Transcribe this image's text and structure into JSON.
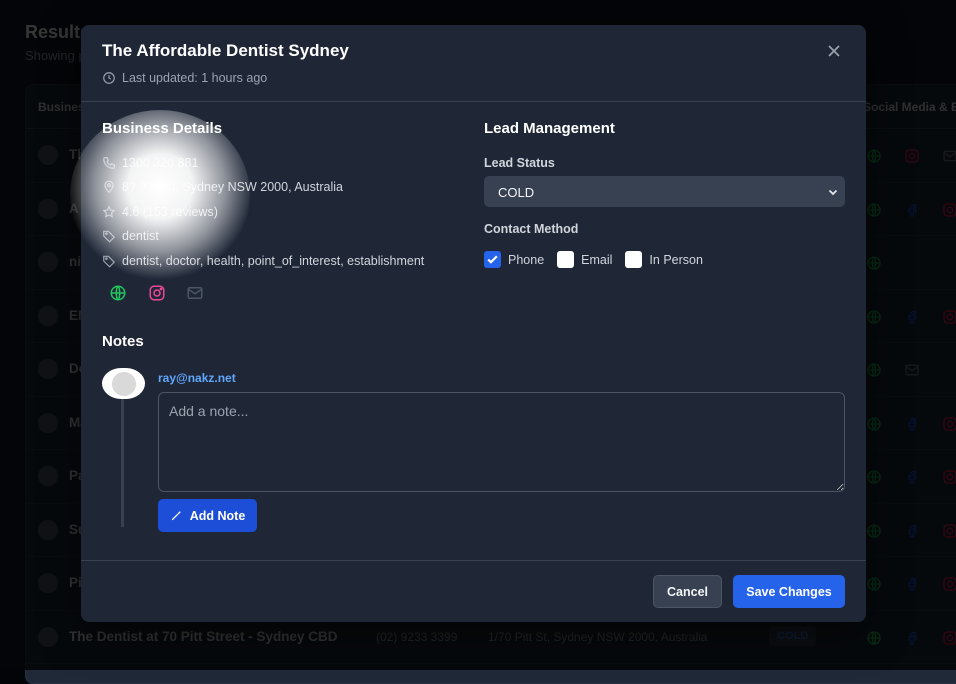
{
  "background": {
    "title": "Results",
    "subtitle": "Showing p",
    "columns": {
      "business": "Business",
      "social": "Social Media & E"
    },
    "rows": [
      {
        "name": "Th",
        "social": [
          "globe",
          "instagram",
          "mail"
        ]
      },
      {
        "name": "A",
        "social": [
          "globe",
          "facebook",
          "instagram"
        ]
      },
      {
        "name": "ni",
        "social": [
          "globe"
        ]
      },
      {
        "name": "EM",
        "social": [
          "globe",
          "facebook",
          "instagram"
        ]
      },
      {
        "name": "De",
        "social": [
          "globe",
          "mail"
        ]
      },
      {
        "name": "Ma",
        "social": [
          "globe",
          "facebook",
          "instagram"
        ]
      },
      {
        "name": "Pa",
        "social": [
          "globe",
          "facebook",
          "instagram"
        ]
      },
      {
        "name": "Su",
        "social": [
          "globe",
          "facebook",
          "instagram"
        ]
      },
      {
        "name": "Pi",
        "social": [
          "globe",
          "facebook",
          "instagram"
        ]
      },
      {
        "name": "The Dentist at 70 Pitt Street - Sydney CBD",
        "phone": "(02) 9233 3399",
        "address": "1/70 Pitt St, Sydney NSW 2000, Australia",
        "status": "COLD",
        "social": [
          "globe",
          "facebook",
          "instagram"
        ]
      }
    ]
  },
  "modal": {
    "title": "The Affordable Dentist Sydney",
    "last_updated": "Last updated: 1 hours ago",
    "business_details": {
      "heading": "Business Details",
      "phone": "1300 320 881",
      "address": "8? ??? St, Sydney NSW 2000, Australia",
      "rating": "4.6 (153 reviews)",
      "primary_type": "dentist",
      "types": "dentist, doctor, health, point_of_interest, establishment",
      "social_links": [
        "website",
        "instagram",
        "email"
      ]
    },
    "lead_management": {
      "heading": "Lead Management",
      "status_label": "Lead Status",
      "status_value": "COLD",
      "contact_label": "Contact Method",
      "contact_methods": [
        {
          "label": "Phone",
          "checked": true
        },
        {
          "label": "Email",
          "checked": false
        },
        {
          "label": "In Person",
          "checked": false
        }
      ]
    },
    "notes": {
      "heading": "Notes",
      "user": "ray@nakz.net",
      "placeholder": "Add a note...",
      "add_label": "Add Note"
    },
    "footer": {
      "cancel_label": "Cancel",
      "save_label": "Save Changes"
    }
  },
  "colors": {
    "accent": "#2563eb",
    "link": "#60a5fa",
    "website": "#22c55e",
    "instagram": "#ec4899",
    "facebook": "#1d4ed8"
  }
}
